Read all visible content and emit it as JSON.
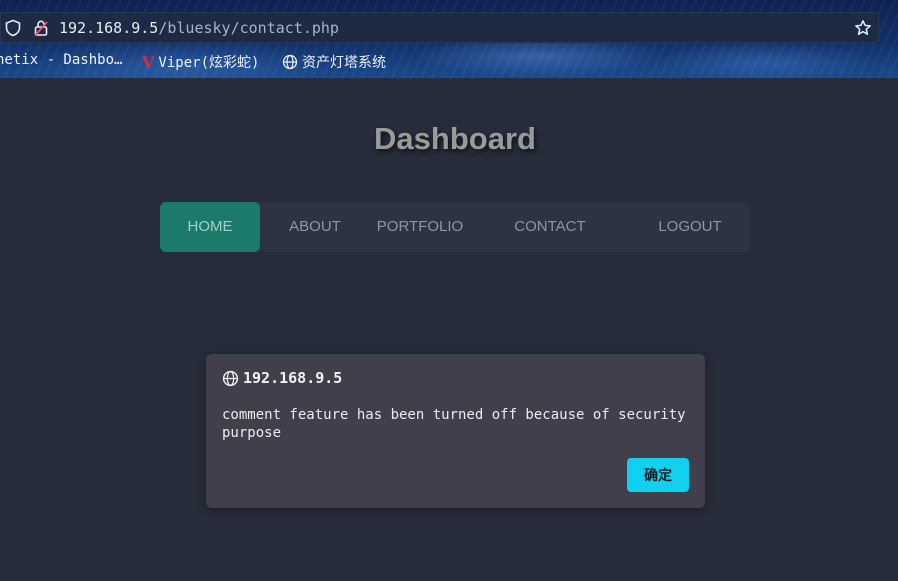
{
  "browser": {
    "url_host": "192.168.9.5",
    "url_path": "/bluesky/contact.php",
    "icons": {
      "tracking": "shield-icon",
      "security": "lock-warning-icon",
      "bookmark": "star-icon"
    }
  },
  "bookmarks": [
    {
      "label": "netix - Dashbo…",
      "icon": ""
    },
    {
      "label": "Viper(炫彩蛇)",
      "icon": "viper-logo-icon"
    },
    {
      "label": "资产灯塔系统",
      "icon": "globe-icon"
    }
  ],
  "page": {
    "title": "Dashboard",
    "nav": [
      {
        "label": "HOME",
        "active": true
      },
      {
        "label": "ABOUT",
        "active": false
      },
      {
        "label": "PORTFOLIO",
        "active": false
      },
      {
        "label": "CONTACT",
        "active": false
      },
      {
        "label": "LOGOUT",
        "active": false
      }
    ]
  },
  "dialog": {
    "host": "192.168.9.5",
    "message": "comment feature has been turned off because of security purpose",
    "ok_label": "确定",
    "icon": "globe-icon"
  },
  "colors": {
    "page_bg": "#262c39",
    "nav_bg": "#2c3443",
    "nav_active": "#1c7a6b",
    "dialog_bg": "#423f4c",
    "ok_button": "#12d0ef"
  }
}
